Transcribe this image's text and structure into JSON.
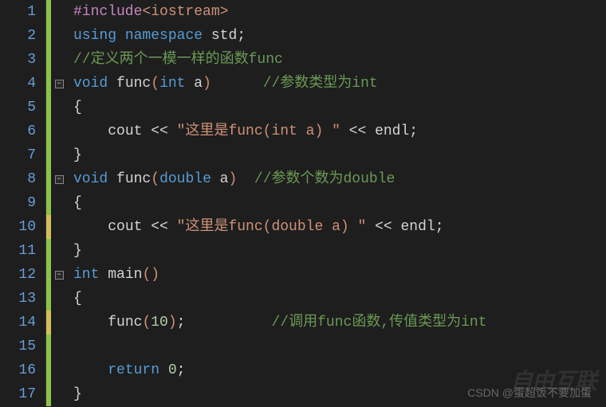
{
  "lines": {
    "1": {
      "num": "1"
    },
    "2": {
      "num": "2"
    },
    "3": {
      "num": "3"
    },
    "4": {
      "num": "4"
    },
    "5": {
      "num": "5"
    },
    "6": {
      "num": "6"
    },
    "7": {
      "num": "7"
    },
    "8": {
      "num": "8"
    },
    "9": {
      "num": "9"
    },
    "10": {
      "num": "10"
    },
    "11": {
      "num": "11"
    },
    "12": {
      "num": "12"
    },
    "13": {
      "num": "13"
    },
    "14": {
      "num": "14"
    },
    "15": {
      "num": "15"
    },
    "16": {
      "num": "16"
    },
    "17": {
      "num": "17"
    }
  },
  "code": {
    "l1_include": "#include",
    "l1_header": "<iostream>",
    "l2_using": "using",
    "l2_namespace": "namespace",
    "l2_std": "std",
    "l2_semi": ";",
    "l3_comment": "//定义两个一模一样的函数func",
    "l4_void": "void",
    "l4_func": "func",
    "l4_lp": "(",
    "l4_int": "int",
    "l4_a": " a",
    "l4_rp": ")",
    "l4_comment": "//参数类型为int",
    "l5_brace": "{",
    "l6_cout": "cout ",
    "l6_op1": "<<",
    "l6_str": " \"这里是func(int a) \" ",
    "l6_op2": "<<",
    "l6_endl": " endl",
    "l6_semi": ";",
    "l7_brace": "}",
    "l8_void": "void",
    "l8_func": "func",
    "l8_lp": "(",
    "l8_double": "double",
    "l8_a": " a",
    "l8_rp": ")",
    "l8_comment": "//参数个数为double",
    "l9_brace": "{",
    "l10_cout": "cout ",
    "l10_op1": "<<",
    "l10_str": " \"这里是func(double a) \" ",
    "l10_op2": "<<",
    "l10_endl": " endl",
    "l10_semi": ";",
    "l11_brace": "}",
    "l12_int": "int",
    "l12_main": "main",
    "l12_lp": "(",
    "l12_rp": ")",
    "l13_brace": "{",
    "l14_func": "func",
    "l14_lp": "(",
    "l14_num": "10",
    "l14_rp": ")",
    "l14_semi": ";",
    "l14_comment": "//调用func函数,传值类型为int",
    "l16_return": "return",
    "l16_zero": " 0",
    "l16_semi": ";",
    "l17_brace": "}"
  },
  "fold": {
    "minus": "−"
  },
  "watermark": {
    "text": "CSDN @蛋超饭不要加蛋",
    "logo": "自由互联"
  }
}
